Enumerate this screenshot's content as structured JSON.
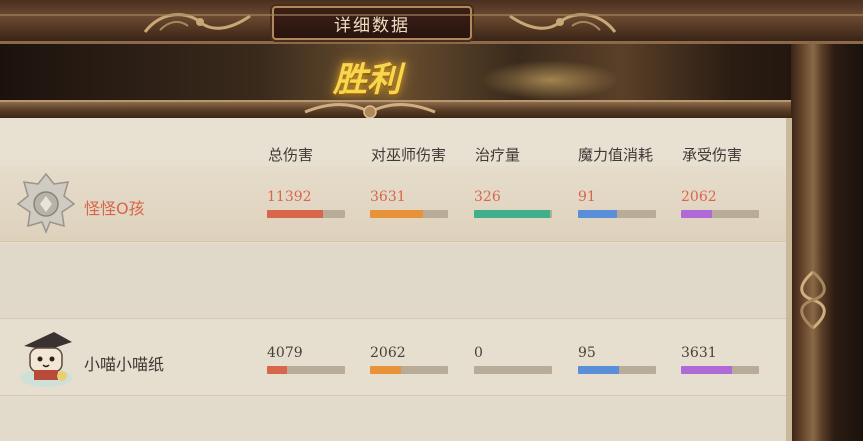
{
  "window": {
    "title": "详细数据",
    "result_banner": "胜利"
  },
  "columns": [
    "总伤害",
    "对巫师伤害",
    "治疗量",
    "魔力值消耗",
    "承受伤害"
  ],
  "colors": {
    "total_damage_bar": "#d8664a",
    "wizard_damage_bar": "#e8923a",
    "healing_bar": "#3fb08a",
    "mana_bar": "#5a8ed8",
    "damage_taken_bar": "#b06ad8"
  },
  "players": [
    {
      "name": "怪怪O孩",
      "avatar_icon": "silver-crest-badge-icon",
      "highlighted": true,
      "stats": [
        {
          "value": "11392",
          "fill": 0.72
        },
        {
          "value": "3631",
          "fill": 0.68
        },
        {
          "value": "326",
          "fill": 0.98
        },
        {
          "value": "91",
          "fill": 0.5
        },
        {
          "value": "2062",
          "fill": 0.4
        }
      ]
    },
    {
      "name": "小喵小喵纸",
      "avatar_icon": "cat-witch-hat-avatar-icon",
      "highlighted": false,
      "stats": [
        {
          "value": "4079",
          "fill": 0.26
        },
        {
          "value": "2062",
          "fill": 0.4
        },
        {
          "value": "0",
          "fill": 0
        },
        {
          "value": "95",
          "fill": 0.52
        },
        {
          "value": "3631",
          "fill": 0.65
        }
      ]
    }
  ]
}
